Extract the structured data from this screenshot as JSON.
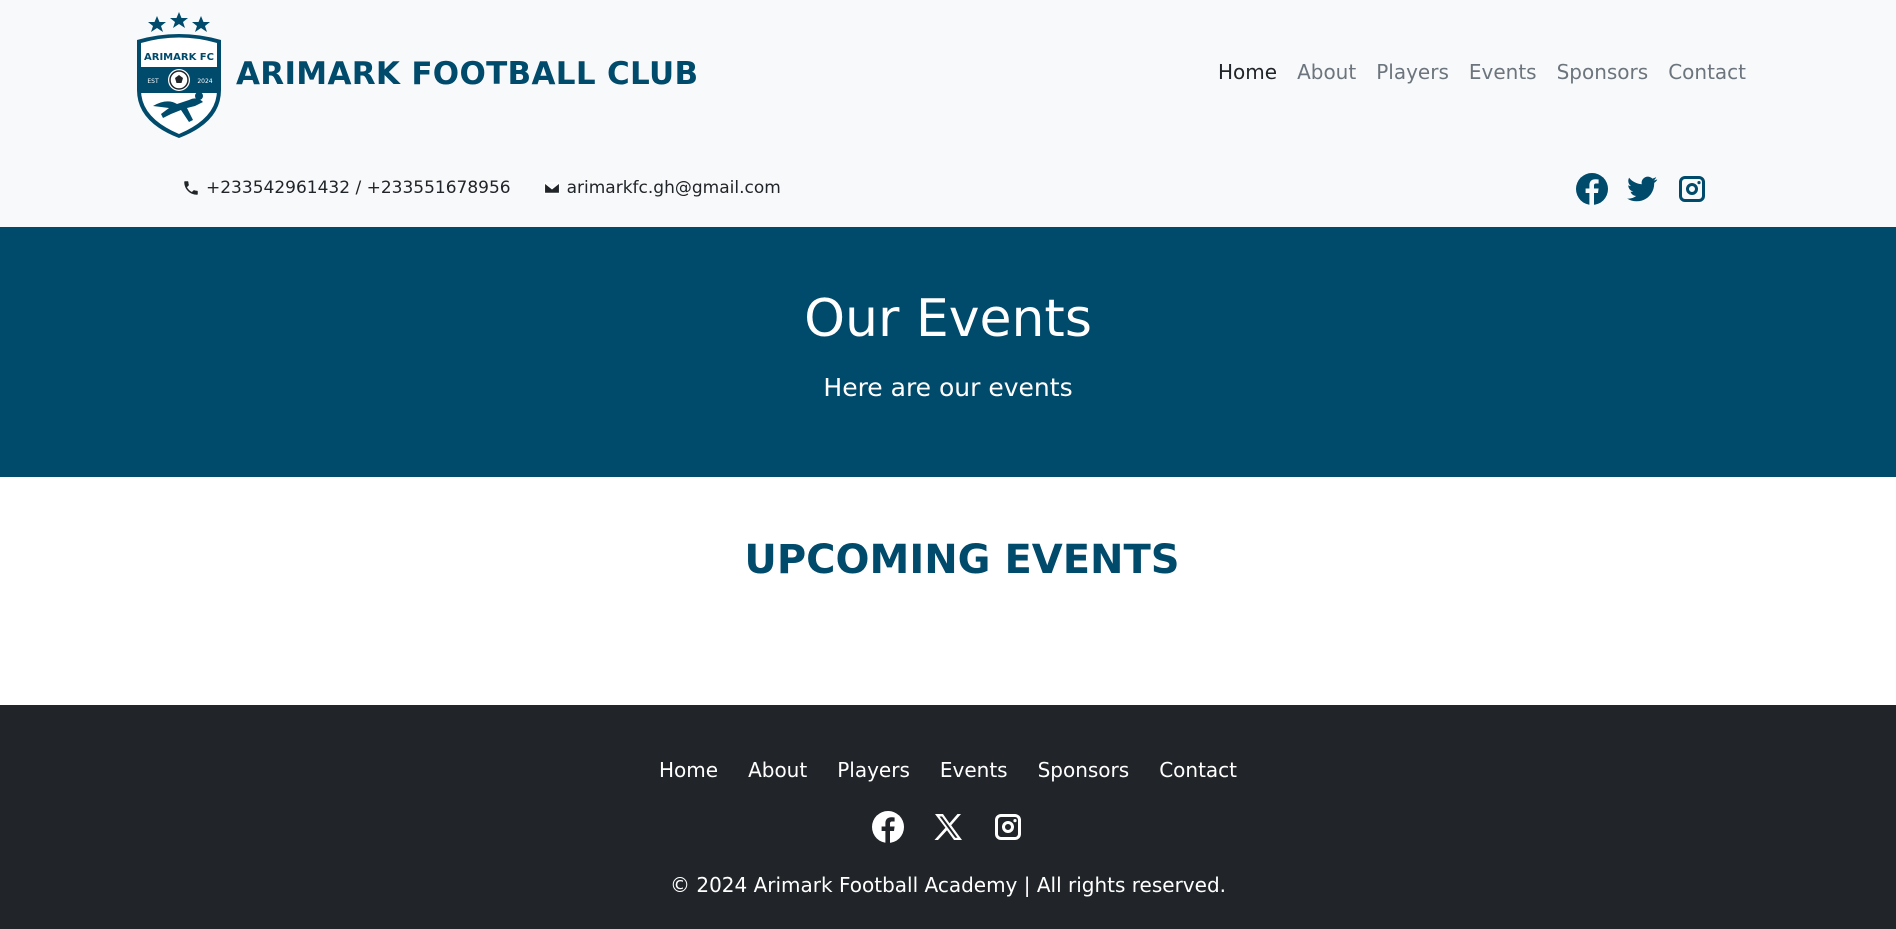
{
  "header": {
    "logo_text": "ARIMARK FC",
    "logo_est": "EST",
    "logo_year": "2024",
    "site_title": "ARIMARK FOOTBALL CLUB",
    "nav": [
      {
        "label": "Home",
        "active": true
      },
      {
        "label": "About"
      },
      {
        "label": "Players"
      },
      {
        "label": "Events"
      },
      {
        "label": "Sponsors"
      },
      {
        "label": "Contact"
      }
    ],
    "phone": "+233542961432 / +233551678956",
    "email": "arimarkfc.gh@gmail.com",
    "social_icons": [
      "facebook-icon",
      "twitter-icon",
      "instagram-icon"
    ]
  },
  "hero": {
    "title": "Our Events",
    "subtitle": "Here are our events"
  },
  "main": {
    "section_title": "UPCOMING EVENTS"
  },
  "footer": {
    "nav": [
      {
        "label": "Home"
      },
      {
        "label": "About"
      },
      {
        "label": "Players"
      },
      {
        "label": "Events"
      },
      {
        "label": "Sponsors"
      },
      {
        "label": "Contact"
      }
    ],
    "social_icons": [
      "facebook-icon",
      "x-icon",
      "instagram-icon"
    ],
    "copyright": "© 2024 Arimark Football Academy | All rights reserved."
  },
  "colors": {
    "brand": "#004a6b",
    "header_bg": "#f8f9fa",
    "footer_bg": "#212529"
  }
}
